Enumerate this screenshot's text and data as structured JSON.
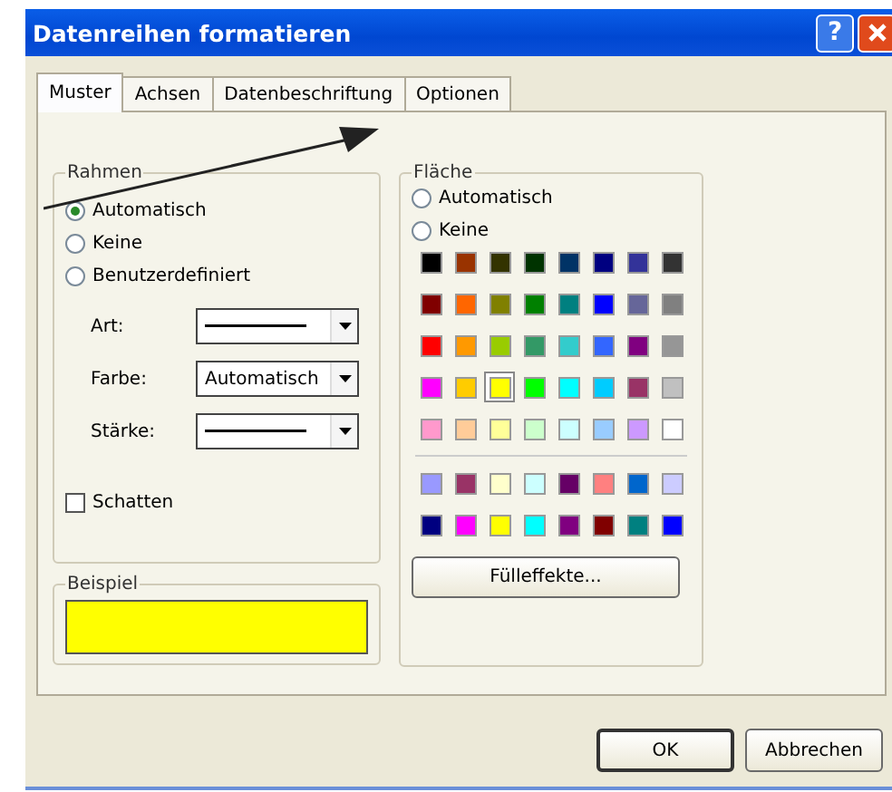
{
  "window": {
    "title": "Datenreihen formatieren",
    "help": "?"
  },
  "tabs": [
    {
      "label": "Muster",
      "selected": true
    },
    {
      "label": "Achsen",
      "selected": false
    },
    {
      "label": "Datenbeschriftung",
      "selected": false
    },
    {
      "label": "Optionen",
      "selected": false
    }
  ],
  "rahmen": {
    "title": "Rahmen",
    "options": [
      {
        "label": "Automatisch",
        "selected": true
      },
      {
        "label": "Keine",
        "selected": false
      },
      {
        "label": "Benutzerdefiniert",
        "selected": false
      }
    ],
    "fields": [
      {
        "label": "Art:",
        "kind": "line"
      },
      {
        "label": "Farbe:",
        "kind": "text",
        "value": "Automatisch"
      },
      {
        "label": "Stärke:",
        "kind": "line"
      }
    ],
    "shadow": {
      "label": "Schatten",
      "checked": false
    }
  },
  "beispiel": {
    "title": "Beispiel",
    "color": "#ffff00"
  },
  "flaeche": {
    "title": "Fläche",
    "options": [
      {
        "label": "Automatisch",
        "selected": false
      },
      {
        "label": "Keine",
        "selected": false
      }
    ],
    "palette": [
      {
        "color": "#000000",
        "selected": false
      },
      {
        "color": "#993300",
        "selected": false
      },
      {
        "color": "#333300",
        "selected": false
      },
      {
        "color": "#003300",
        "selected": false
      },
      {
        "color": "#003366",
        "selected": false
      },
      {
        "color": "#000080",
        "selected": false
      },
      {
        "color": "#333399",
        "selected": false
      },
      {
        "color": "#333333",
        "selected": false
      },
      {
        "color": "#800000",
        "selected": false
      },
      {
        "color": "#ff6600",
        "selected": false
      },
      {
        "color": "#808000",
        "selected": false
      },
      {
        "color": "#008000",
        "selected": false
      },
      {
        "color": "#008080",
        "selected": false
      },
      {
        "color": "#0000ff",
        "selected": false
      },
      {
        "color": "#666699",
        "selected": false
      },
      {
        "color": "#808080",
        "selected": false
      },
      {
        "color": "#ff0000",
        "selected": false
      },
      {
        "color": "#ff9900",
        "selected": false
      },
      {
        "color": "#99cc00",
        "selected": false
      },
      {
        "color": "#339966",
        "selected": false
      },
      {
        "color": "#33cccc",
        "selected": false
      },
      {
        "color": "#3366ff",
        "selected": false
      },
      {
        "color": "#800080",
        "selected": false
      },
      {
        "color": "#969696",
        "selected": false
      },
      {
        "color": "#ff00ff",
        "selected": false
      },
      {
        "color": "#ffcc00",
        "selected": false
      },
      {
        "color": "#ffff00",
        "selected": true
      },
      {
        "color": "#00ff00",
        "selected": false
      },
      {
        "color": "#00ffff",
        "selected": false
      },
      {
        "color": "#00ccff",
        "selected": false
      },
      {
        "color": "#993366",
        "selected": false
      },
      {
        "color": "#c0c0c0",
        "selected": false
      },
      {
        "color": "#ff99cc",
        "selected": false
      },
      {
        "color": "#ffcc99",
        "selected": false
      },
      {
        "color": "#ffff99",
        "selected": false
      },
      {
        "color": "#ccffcc",
        "selected": false
      },
      {
        "color": "#ccffff",
        "selected": false
      },
      {
        "color": "#99ccff",
        "selected": false
      },
      {
        "color": "#cc99ff",
        "selected": false
      },
      {
        "color": "#ffffff",
        "selected": false
      }
    ],
    "extra": [
      {
        "color": "#9999ff"
      },
      {
        "color": "#993366"
      },
      {
        "color": "#ffffcc"
      },
      {
        "color": "#ccffff"
      },
      {
        "color": "#660066"
      },
      {
        "color": "#ff8080"
      },
      {
        "color": "#0066cc"
      },
      {
        "color": "#ccccff"
      },
      {
        "color": "#000080"
      },
      {
        "color": "#ff00ff"
      },
      {
        "color": "#ffff00"
      },
      {
        "color": "#00ffff"
      },
      {
        "color": "#800080"
      },
      {
        "color": "#800000"
      },
      {
        "color": "#008080"
      },
      {
        "color": "#0000ff"
      }
    ],
    "button": "Fülleffekte..."
  },
  "buttons": [
    {
      "label": "OK",
      "default": true
    },
    {
      "label": "Abbrechen",
      "default": false
    }
  ]
}
